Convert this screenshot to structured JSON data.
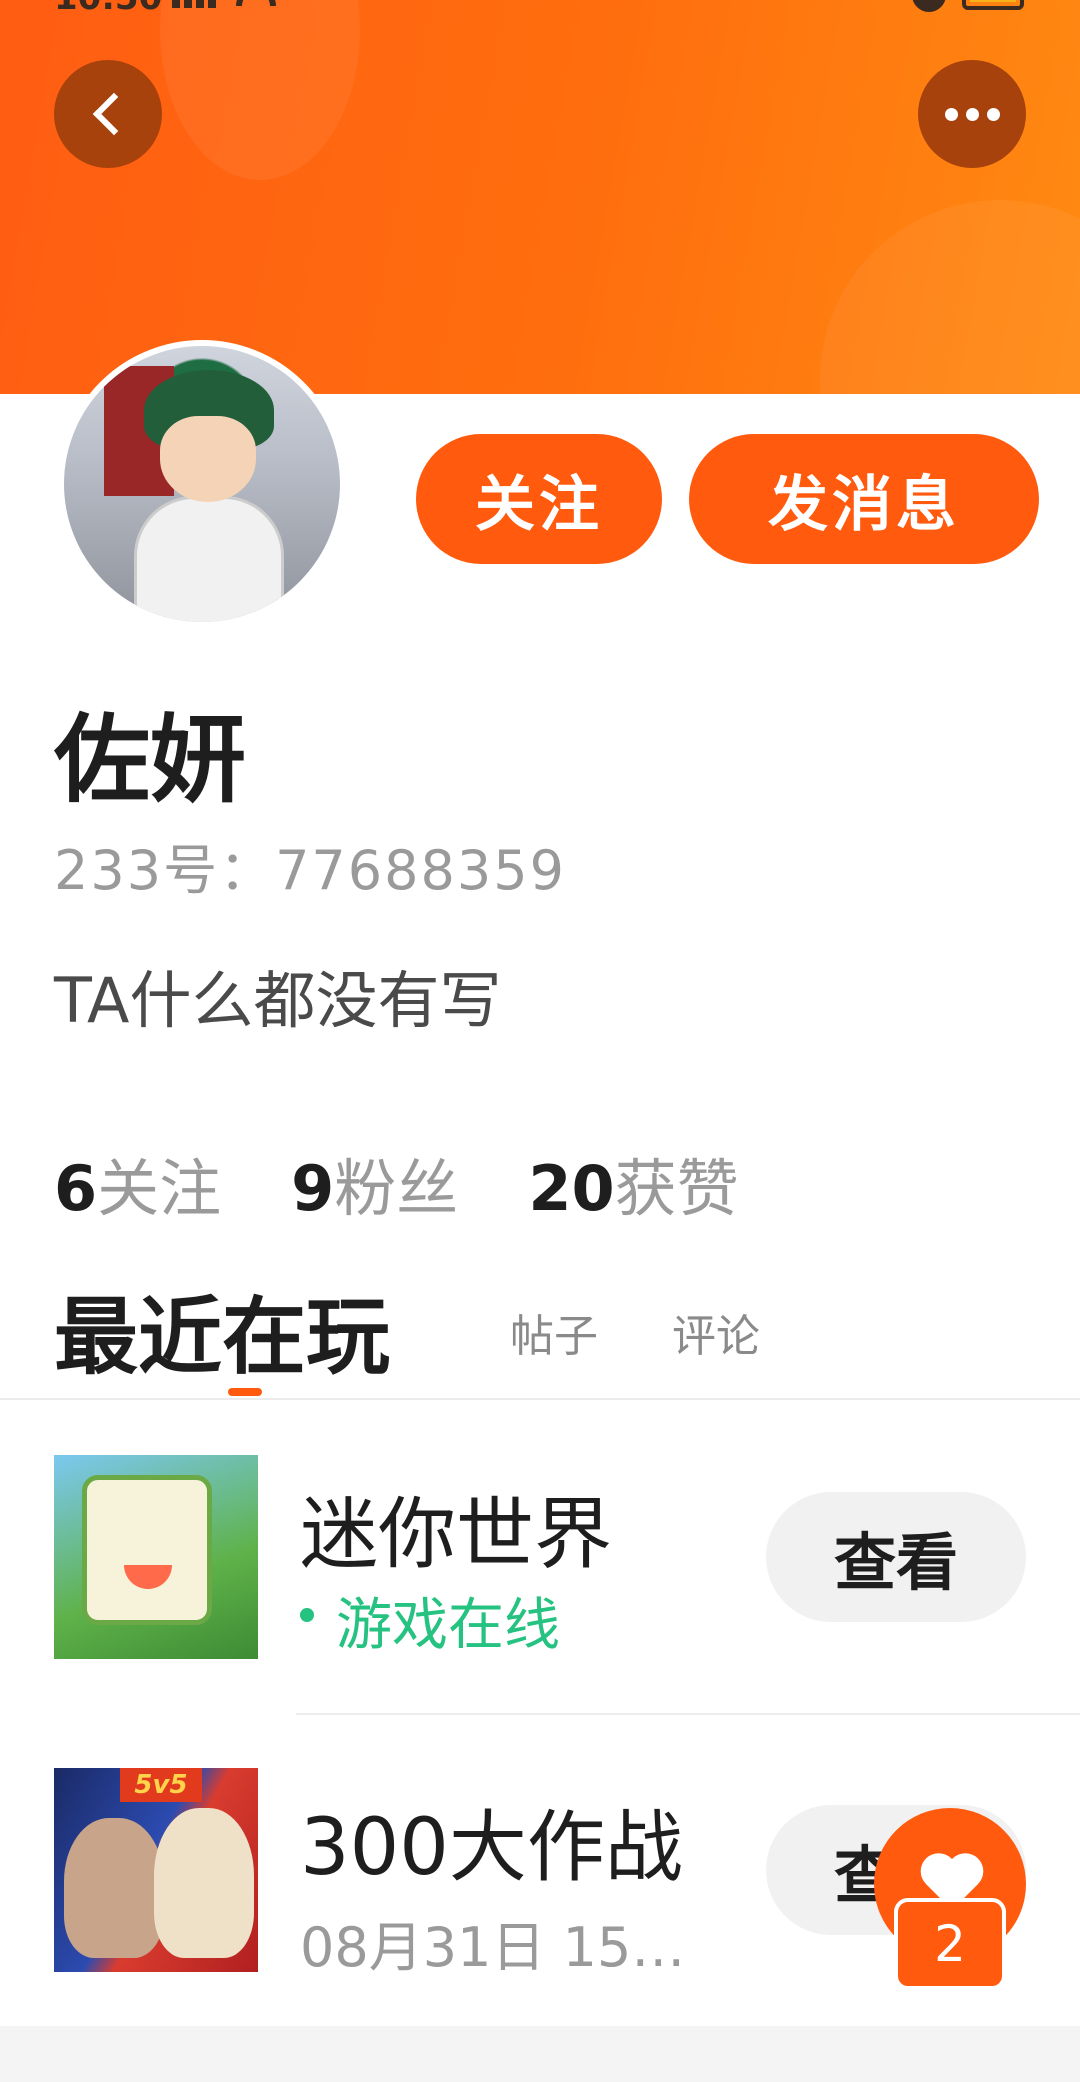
{
  "status_bar": {
    "time": "10:50",
    "battery": "60"
  },
  "header": {
    "back_icon": "chevron-left-icon",
    "more_icon": "more-horizontal-icon",
    "accent": "#ff5a0d"
  },
  "profile": {
    "follow_label": "关注",
    "message_label": "发消息",
    "username": "佐妍",
    "user_id": "233号：77688359",
    "bio": "TA什么都没有写",
    "stats": [
      {
        "num": "6",
        "label": "关注"
      },
      {
        "num": "9",
        "label": "粉丝"
      },
      {
        "num": "20",
        "label": "获赞"
      }
    ]
  },
  "tabs": {
    "active": "最近在玩",
    "posts": "帖子",
    "comments": "评论"
  },
  "games": [
    {
      "name": "迷你世界",
      "status": "游戏在线",
      "view_label": "查看",
      "status_color": "#26c281"
    },
    {
      "name": "300大作战",
      "time": "08月31日 15…",
      "view_label": "查看",
      "icon_tag": "5v5"
    }
  ],
  "fab": {
    "icon": "heart-icon",
    "badge": "2"
  }
}
